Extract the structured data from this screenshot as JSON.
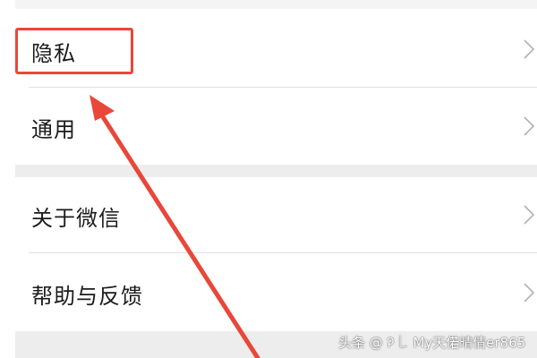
{
  "settings": {
    "items": [
      {
        "label": "隐私",
        "icon": "chevron-right-icon"
      },
      {
        "label": "通用",
        "icon": "chevron-right-icon"
      },
      {
        "label": "关于微信",
        "icon": "chevron-right-icon"
      },
      {
        "label": "帮助与反馈",
        "icon": "chevron-right-icon"
      }
    ]
  },
  "annotation": {
    "highlight_color": "#e8473a",
    "arrow_color": "#e8473a",
    "highlighted_item": "隐私"
  },
  "watermark": {
    "text": "头条 @ Ꭾ ꒒ My天偌晴倩er865"
  },
  "colors": {
    "background": "#ffffff",
    "separator": "#ededed",
    "chevron": "#b2b2b2",
    "text": "#1b1b1b"
  }
}
